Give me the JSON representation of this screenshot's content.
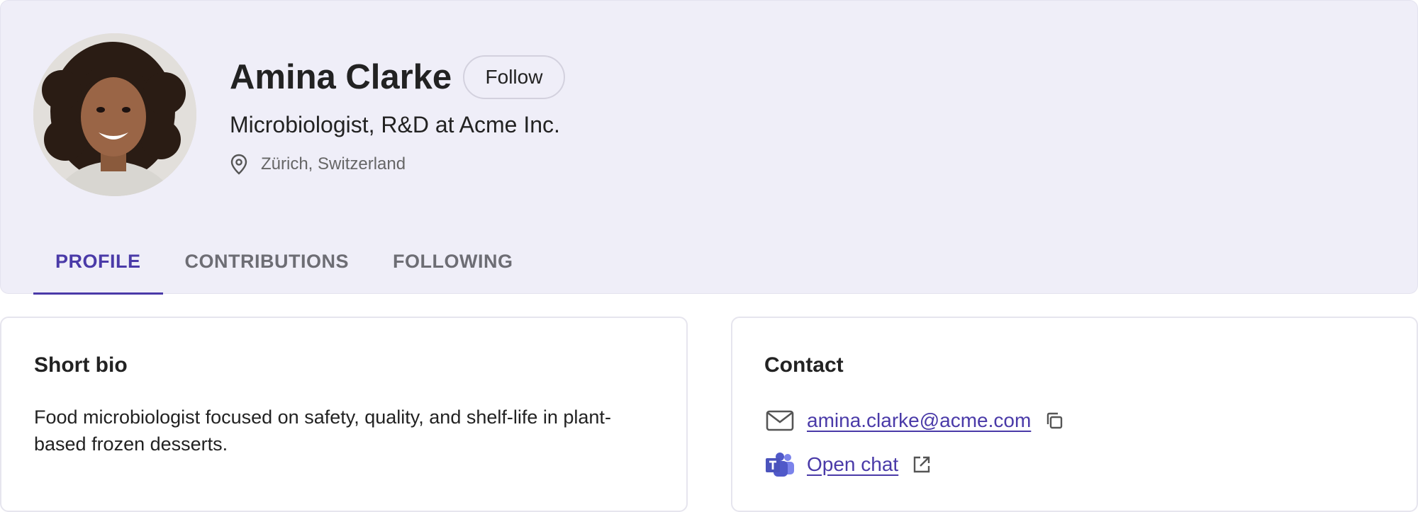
{
  "profile": {
    "name": "Amina Clarke",
    "follow_label": "Follow",
    "job_title": "Microbiologist, R&D at Acme Inc.",
    "location": "Zürich, Switzerland",
    "avatar_icon": "profile-photo"
  },
  "tabs": [
    {
      "label": "PROFILE",
      "active": true
    },
    {
      "label": "CONTRIBUTIONS",
      "active": false
    },
    {
      "label": "FOLLOWING",
      "active": false
    }
  ],
  "bio": {
    "title": "Short bio",
    "text": "Food microbiologist focused on safety, quality, and shelf-life in plant-based frozen desserts."
  },
  "contact": {
    "title": "Contact",
    "email": "amina.clarke@acme.com",
    "email_icon": "mail-icon",
    "copy_icon": "copy-icon",
    "chat_label": "Open chat",
    "chat_icon": "teams-icon",
    "external_icon": "external-link-icon"
  },
  "colors": {
    "accent": "#4a3aa8",
    "header_bg": "#efeef8",
    "muted_text": "#666666"
  }
}
